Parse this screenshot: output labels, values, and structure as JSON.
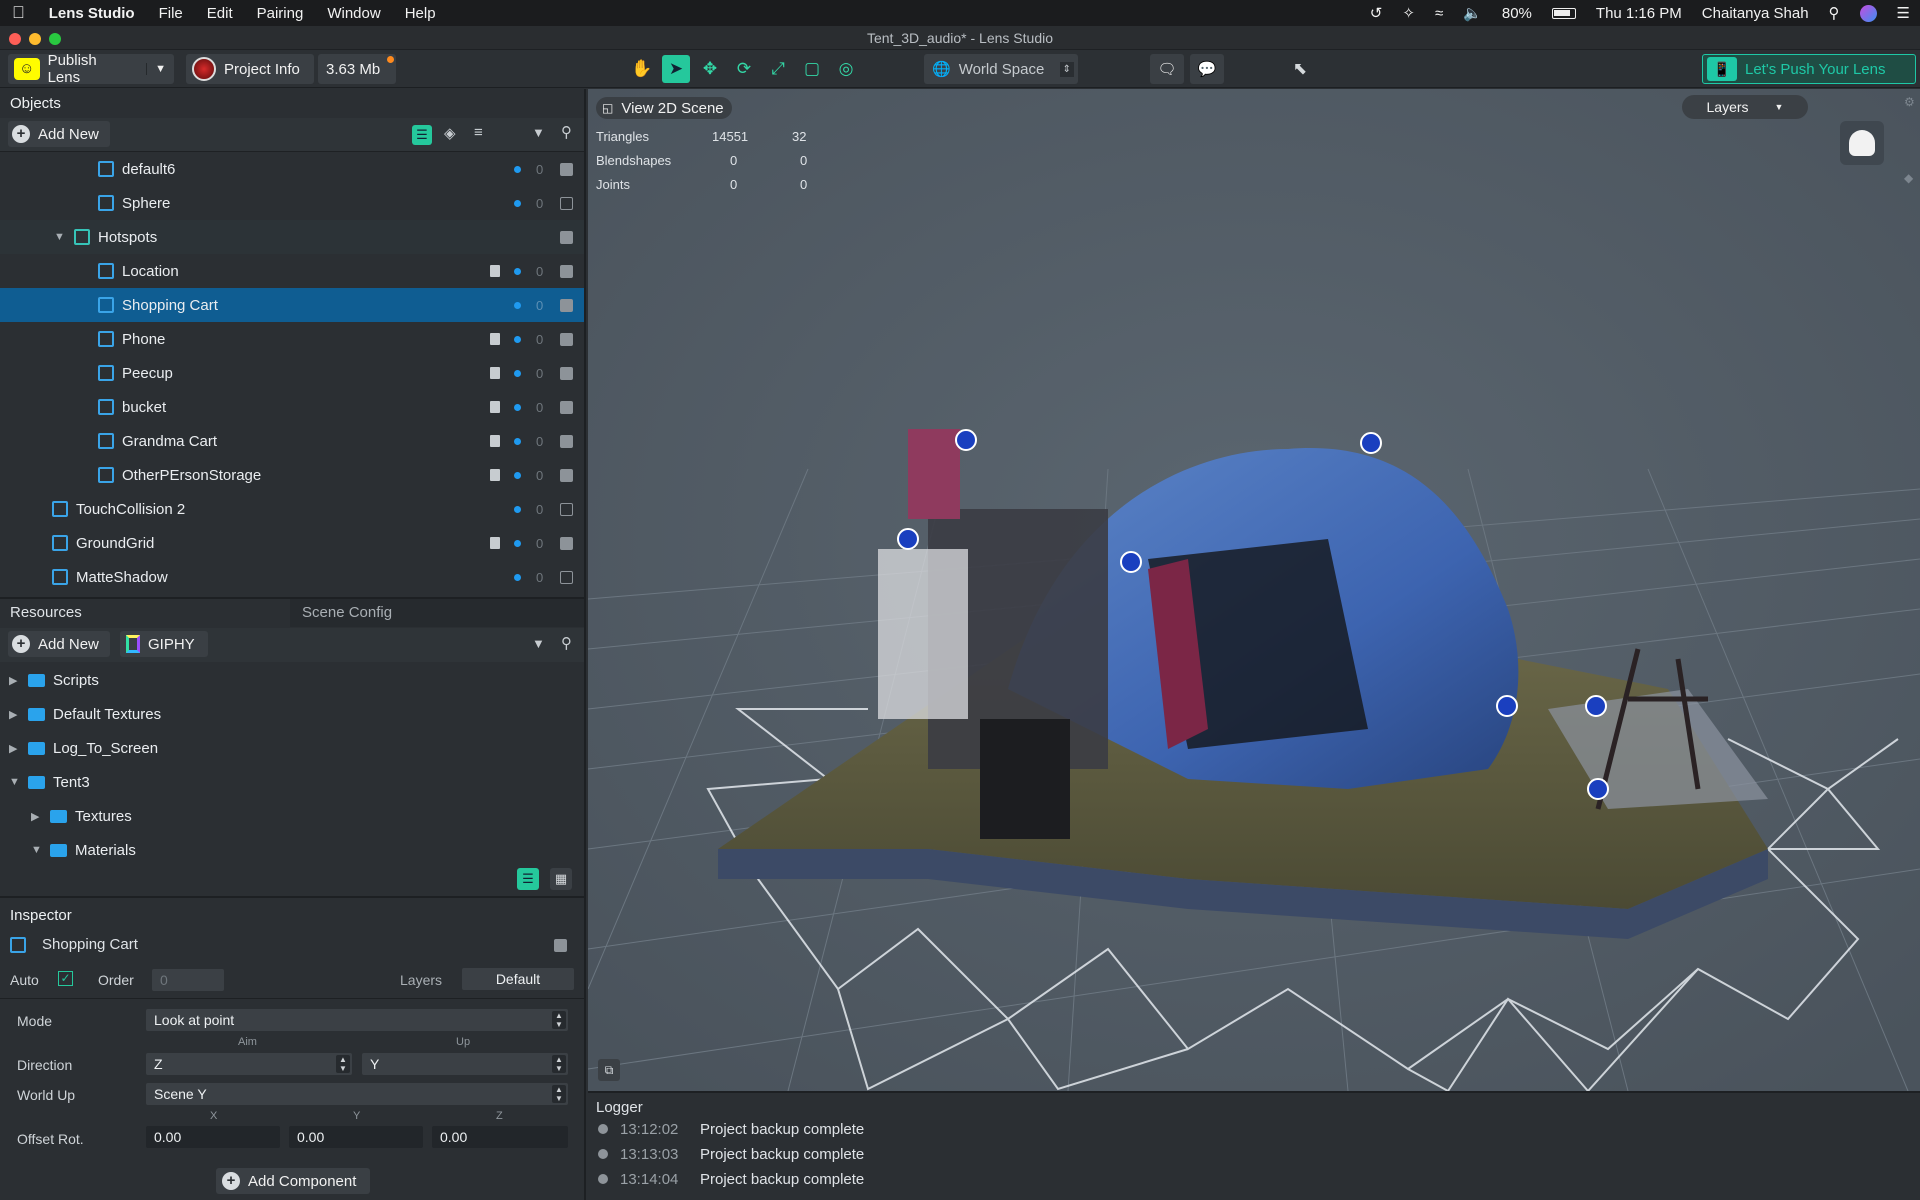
{
  "menubar": {
    "app": "Lens Studio",
    "items": [
      "File",
      "Edit",
      "Pairing",
      "Window",
      "Help"
    ],
    "battery": "80%",
    "clock": "Thu 1:16 PM",
    "user": "Chaitanya Shah"
  },
  "window": {
    "title": "Tent_3D_audio* - Lens Studio"
  },
  "toolbar": {
    "publish": "Publish Lens",
    "project_info": "Project Info",
    "size": "3.63 Mb",
    "space": "World Space",
    "promo": "Let's Push Your Lens"
  },
  "objects": {
    "header": "Objects",
    "add_new": "Add New",
    "rows": [
      {
        "label": "default6",
        "count": "0"
      },
      {
        "label": "Sphere",
        "count": "0"
      },
      {
        "label": "Hotspots"
      },
      {
        "label": "Location",
        "count": "0"
      },
      {
        "label": "Shopping Cart",
        "count": "0"
      },
      {
        "label": "Phone",
        "count": "0"
      },
      {
        "label": "Peecup",
        "count": "0"
      },
      {
        "label": "bucket",
        "count": "0"
      },
      {
        "label": "Grandma Cart",
        "count": "0"
      },
      {
        "label": "OtherPErsonStorage",
        "count": "0"
      },
      {
        "label": "TouchCollision 2",
        "count": "0"
      },
      {
        "label": "GroundGrid",
        "count": "0"
      },
      {
        "label": "MatteShadow",
        "count": "0"
      }
    ]
  },
  "resources": {
    "tab_resources": "Resources",
    "tab_scene_config": "Scene Config",
    "add_new": "Add New",
    "giphy": "GIPHY",
    "rows": [
      "Scripts",
      "Default Textures",
      "Log_To_Screen",
      "Tent3",
      "Textures",
      "Materials"
    ]
  },
  "inspector": {
    "header": "Inspector",
    "object": "Shopping Cart",
    "auto": "Auto",
    "order": "Order",
    "order_value": "0",
    "layers": "Layers",
    "layers_value": "Default",
    "mode_label": "Mode",
    "mode_value": "Look at point",
    "aim": "Aim",
    "up": "Up",
    "direction_label": "Direction",
    "direction_aim": "Z",
    "direction_up": "Y",
    "world_up_label": "World Up",
    "world_up_value": "Scene Y",
    "x": "X",
    "y": "Y",
    "z": "Z",
    "offset_label": "Offset Rot.",
    "offset_x": "0.00",
    "offset_y": "0.00",
    "offset_z": "0.00",
    "add_component": "Add Component"
  },
  "viewport": {
    "view2d": "View 2D Scene",
    "layers": "Layers",
    "stats": [
      {
        "label": "Triangles",
        "a": "14551",
        "b": "32"
      },
      {
        "label": "Blendshapes",
        "a": "0",
        "b": "0"
      },
      {
        "label": "Joints",
        "a": "0",
        "b": "0"
      }
    ]
  },
  "logger": {
    "header": "Logger",
    "entries": [
      {
        "time": "13:12:02",
        "msg": "Project backup complete"
      },
      {
        "time": "13:13:03",
        "msg": "Project backup complete"
      },
      {
        "time": "13:14:04",
        "msg": "Project backup complete"
      }
    ]
  },
  "colors": {
    "accent": "#1f9af0",
    "selected_row": "#0f5d92",
    "teal": "#1ec8a6"
  }
}
